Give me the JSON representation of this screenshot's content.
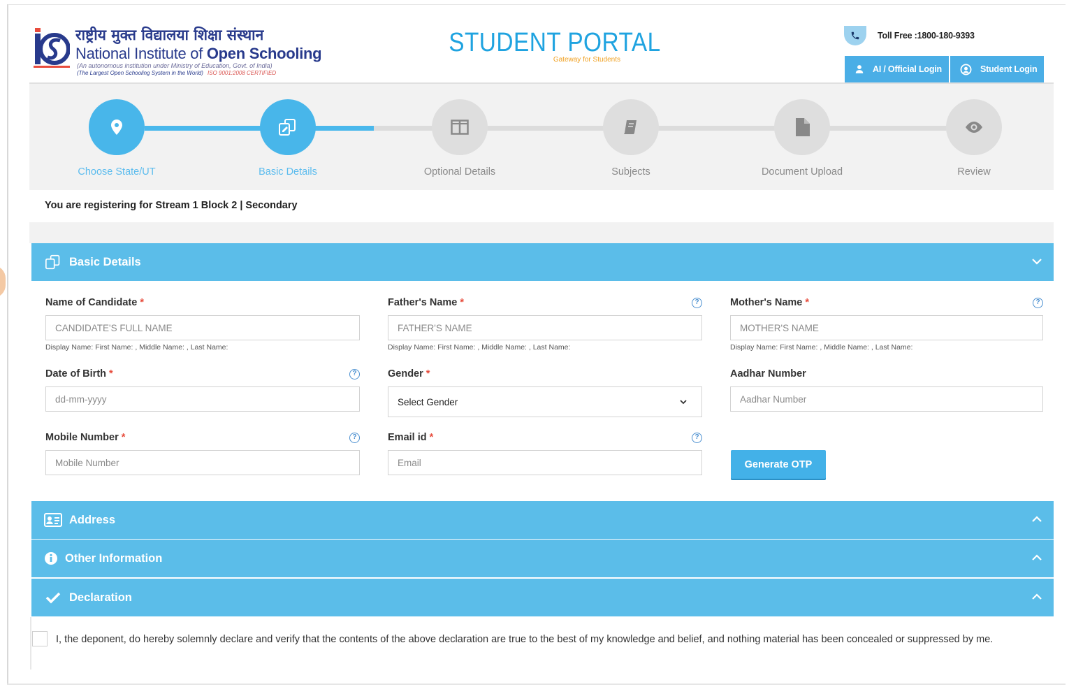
{
  "header": {
    "logo_hindi": "राष्ट्रीय मुक्त विद्यालया शिक्षा संस्थान",
    "logo_english_regular": "National Institute of ",
    "logo_english_bold": "Open Schooling",
    "logo_sub1": "(An autonomous institution under Ministry of Education, Govt. of India)",
    "logo_sub2": "(The Largest Open Schooling System in the World)",
    "logo_cert": "ISO 9001:2008 CERTIFIED",
    "portal_title": "STUDENT PORTAL",
    "portal_subtitle": "Gateway for Students",
    "toll_free": "Toll Free :1800-180-9393",
    "official_login": "AI / Official Login",
    "student_login": "Student Login"
  },
  "stepper": {
    "steps": [
      {
        "label": "Choose State/UT",
        "icon": "map-pin-icon",
        "active": true
      },
      {
        "label": "Basic Details",
        "icon": "edit-copy-icon",
        "active": true
      },
      {
        "label": "Optional Details",
        "icon": "columns-icon",
        "active": false
      },
      {
        "label": "Subjects",
        "icon": "book-icon",
        "active": false
      },
      {
        "label": "Document Upload",
        "icon": "file-icon",
        "active": false
      },
      {
        "label": "Review",
        "icon": "eye-icon",
        "active": false
      }
    ]
  },
  "registration_info": "You are registering for Stream 1 Block 2 | Secondary",
  "panels": {
    "basic_details": "Basic Details",
    "address": "Address",
    "other_information": "Other Information",
    "declaration": "Declaration"
  },
  "form": {
    "candidate_name": {
      "label": "Name of Candidate",
      "placeholder": "CANDIDATE'S FULL NAME",
      "hint": "Display Name: First Name: , Middle Name: , Last Name:"
    },
    "father_name": {
      "label": "Father's Name",
      "placeholder": "FATHER'S NAME",
      "hint": "Display Name: First Name: , Middle Name: , Last Name:"
    },
    "mother_name": {
      "label": "Mother's Name",
      "placeholder": "MOTHER'S NAME",
      "hint": "Display Name: First Name: , Middle Name: , Last Name:"
    },
    "dob": {
      "label": "Date of Birth",
      "placeholder": "dd-mm-yyyy"
    },
    "gender": {
      "label": "Gender",
      "selected": "Select Gender"
    },
    "aadhar": {
      "label": "Aadhar Number",
      "placeholder": "Aadhar Number"
    },
    "mobile": {
      "label": "Mobile Number",
      "placeholder": "Mobile Number"
    },
    "email": {
      "label": "Email id",
      "placeholder": "Email"
    },
    "required_mark": "*",
    "help_mark": "?",
    "generate_otp": "Generate OTP"
  },
  "declaration_text": "I, the deponent, do hereby solemnly declare and verify that the contents of the above declaration are true to the best of my knowledge and belief, and nothing material has been concealed or suppressed by me.",
  "colors": {
    "primary": "#5bbde9",
    "active_step": "#48b6ea",
    "inactive_step": "#dedede",
    "brand_navy": "#283a8c",
    "portal_blue": "#1fa3e0",
    "required": "#e74c3c"
  }
}
